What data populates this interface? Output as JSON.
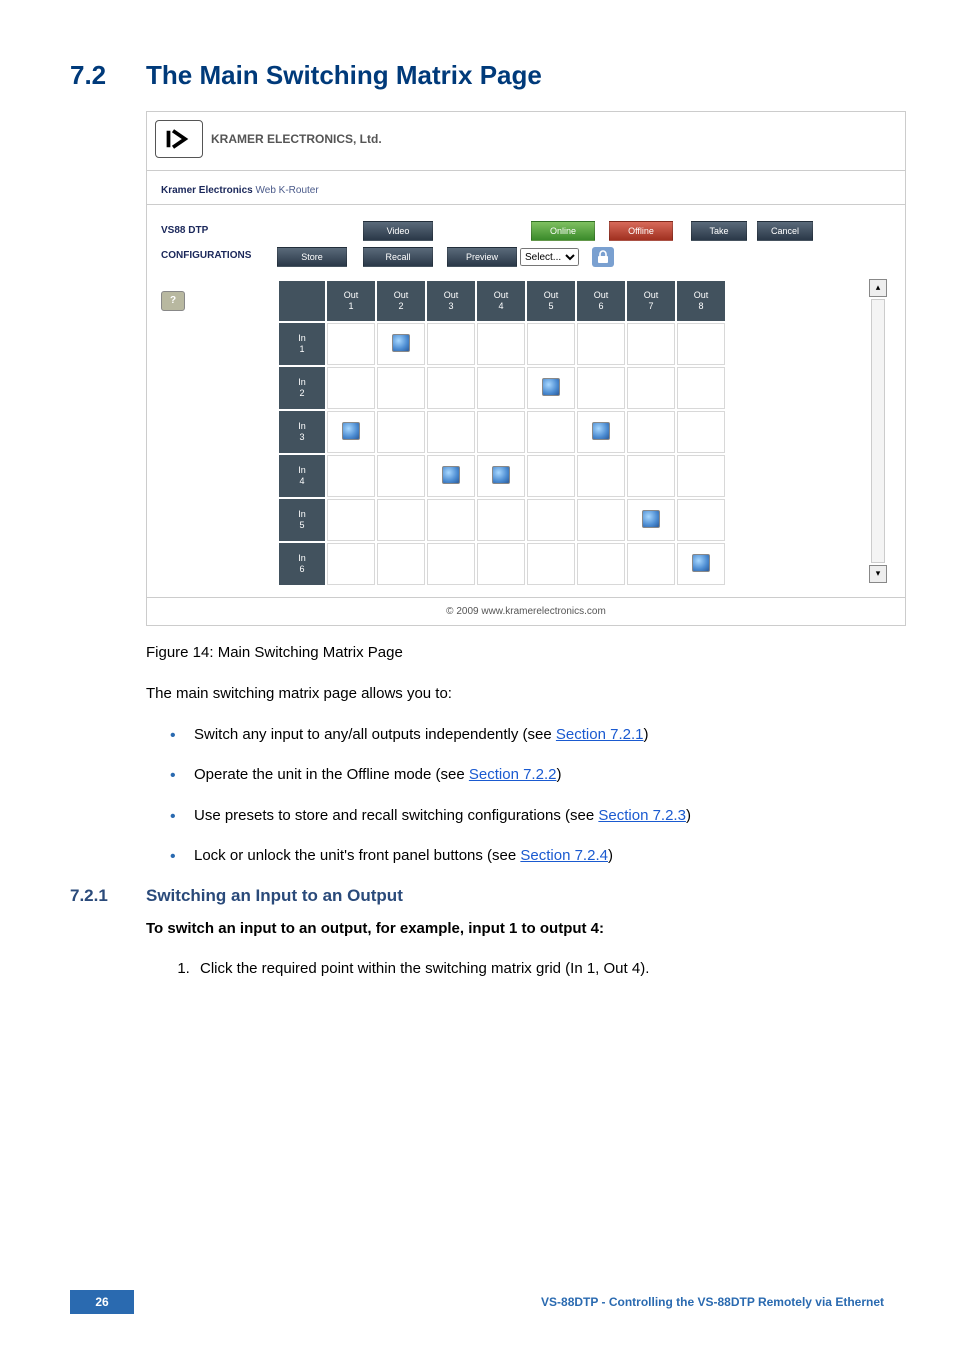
{
  "section": {
    "num": "7.2",
    "title": "The Main Switching Matrix Page"
  },
  "subsection": {
    "num": "7.2.1",
    "title": "Switching an Input to an Output"
  },
  "screenshot": {
    "logo_label": "KRAMER",
    "company": "KRAMER ELECTRONICS, Ltd.",
    "breadcrumb_prefix": "Kramer Electronics",
    "breadcrumb_suffix": " Web K-Router",
    "side_links": {
      "product": "VS88 DTP",
      "configs": "CONFIGURATIONS",
      "help": "?"
    },
    "buttons": {
      "video": "Video",
      "online": "Online",
      "offline": "Offline",
      "take": "Take",
      "cancel": "Cancel",
      "store": "Store",
      "recall": "Recall",
      "preview": "Preview",
      "select_placeholder": "Select..."
    },
    "matrix": {
      "cols": [
        "Out\n1",
        "Out\n2",
        "Out\n3",
        "Out\n4",
        "Out\n5",
        "Out\n6",
        "Out\n7",
        "Out\n8"
      ],
      "rows": [
        "In\n1",
        "In\n2",
        "In\n3",
        "In\n4",
        "In\n5",
        "In\n6"
      ],
      "cells": [
        [
          1,
          2
        ],
        [
          2,
          5
        ],
        [
          3,
          1
        ],
        [
          3,
          6
        ],
        [
          4,
          3
        ],
        [
          4,
          4
        ],
        [
          5,
          7
        ],
        [
          6,
          8
        ]
      ]
    },
    "footer": "© 2009 www.kramerelectronics.com"
  },
  "caption": "Figure 14: Main Switching Matrix Page",
  "intro": "The main switching matrix page allows you to:",
  "bullets": [
    {
      "text": "Switch any input to any/all outputs independently (see ",
      "link": "Section 7.2.1",
      "after": ")"
    },
    {
      "text": "Operate the unit in the Offline mode (see ",
      "link": "Section 7.2.2",
      "after": ")"
    },
    {
      "text": "Use presets to store and recall switching configurations (see ",
      "link": "Section 7.2.3",
      "after": ")"
    },
    {
      "text": "Lock or unlock the unit's front panel buttons (see ",
      "link": "Section 7.2.4",
      "after": ")"
    }
  ],
  "bold_line": "To switch an input to an output, for example, input 1 to output 4:",
  "steps": [
    "Click the required point within the switching matrix grid (In 1, Out 4)."
  ],
  "pagefoot": {
    "num": "26",
    "title": "VS-88DTP - Controlling the VS-88DTP Remotely via Ethernet"
  }
}
